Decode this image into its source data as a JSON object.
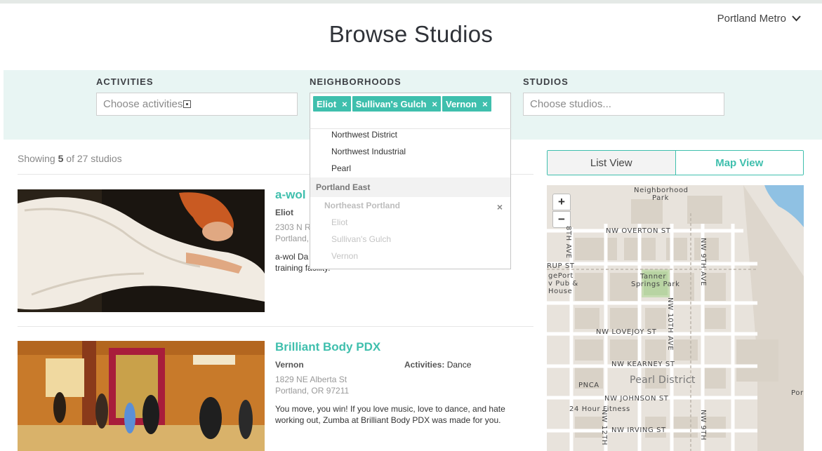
{
  "header": {
    "title": "Browse Studios",
    "region": "Portland Metro"
  },
  "filters": {
    "activities": {
      "label": "ACTIVITIES",
      "placeholder": "Choose activities"
    },
    "neighborhoods": {
      "label": "NEIGHBORHOODS",
      "tags": [
        "Eliot",
        "Sullivan's Gulch",
        "Vernon"
      ],
      "tag_remove": "×",
      "dropdown": {
        "items": [
          "Northwest District",
          "Northwest Industrial",
          "Pearl"
        ],
        "group": "Portland East",
        "subgroup": "Northeast Portland",
        "subgroup_close": "×",
        "disabled_items": [
          "Eliot",
          "Sullivan's Gulch",
          "Vernon"
        ]
      }
    },
    "studios": {
      "label": "STUDIOS",
      "placeholder": "Choose studios..."
    }
  },
  "results": {
    "showing_prefix": "Showing ",
    "shown": "5",
    "showing_suffix": " of 27 studios"
  },
  "studios": [
    {
      "name": "a-wol",
      "neighborhood": "Eliot",
      "address_line1": "2303 N R",
      "address_line2": "Portland,",
      "description_line1": "a-wol Da",
      "description_line2": "training facility."
    },
    {
      "name": "Brilliant Body PDX",
      "neighborhood": "Vernon",
      "activities_label": "Activities:",
      "activities": "Dance",
      "address_line1": "1829 NE Alberta St",
      "address_line2": "Portland, OR 97211",
      "description_line1": "You move, you win! If you love music, love to dance, and hate",
      "description_line2": "working out, Zumba at Brilliant Body PDX was made for you."
    }
  ],
  "view_toggle": {
    "list": "List View",
    "map": "Map View",
    "active": "list"
  },
  "map": {
    "zoom_in": "+",
    "zoom_out": "−",
    "labels": {
      "park1_line1": "Neighborhood",
      "park1_line2": "Park",
      "overton": "NW OVERTON ST",
      "ave8": "8TH AVE",
      "ave9": "NW 9TH AVE",
      "rup": "RUP ST",
      "pub1": "gePort",
      "pub2": "v Pub &",
      "pub3": "House",
      "tanner1": "Tanner",
      "tanner2": "Springs Park",
      "ave10": "NW 10TH AVE",
      "lovejoy": "NW LOVEJOY ST",
      "kearney": "NW KEARNEY ST",
      "pnca": "PNCA",
      "pearl": "Pearl District",
      "johnson": "NW JOHNSON ST",
      "fitness": "24 Hour Fitness",
      "por": "Por",
      "irving": "NW IRVING ST",
      "ave12": "NW 12TH",
      "ave9b": "NW 9TH"
    }
  },
  "colors": {
    "accent": "#3fbfad",
    "filter_bg": "#e8f5f3",
    "map_bg": "#e8e3dc",
    "water": "#8fc1e3",
    "park": "#b8d4a3"
  }
}
